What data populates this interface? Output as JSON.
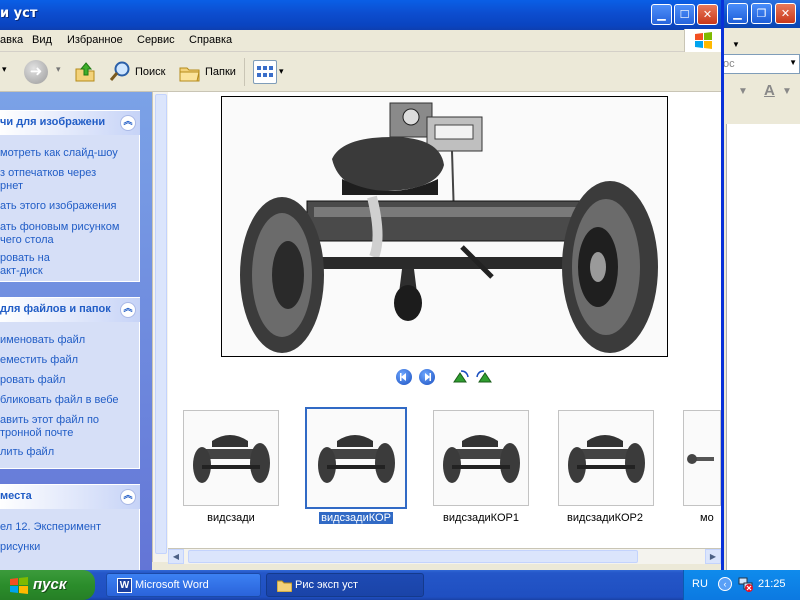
{
  "explorer": {
    "title": "и уст",
    "menu": [
      "авка",
      "Вид",
      "Избранное",
      "Сервис",
      "Справка"
    ],
    "toolbar": {
      "search_label": "Поиск",
      "folders_label": "Папки"
    }
  },
  "taskpane": {
    "image_tasks": {
      "title": "чи для изображени",
      "links": [
        "мотреть как слайд-шоу",
        "з отпечатков через\nрнет",
        "ать этого изображения",
        "ать фоновым рисунком\nчего стола",
        "ровать на\nакт-диск"
      ]
    },
    "file_tasks": {
      "title": "для файлов и папок",
      "links": [
        "именовать файл",
        "еместить файл",
        "ровать файл",
        "бликовать файл в вебе",
        "авить этот файл по\nтронной почте",
        "лить файл"
      ]
    },
    "places": {
      "title": "места",
      "links": [
        "ел 12. Эксперимент",
        "рисунки"
      ]
    }
  },
  "thumbnails": [
    {
      "label": "видсзади",
      "selected": false
    },
    {
      "label": "видсзадиКОР",
      "selected": true
    },
    {
      "label": "видсзадиКОР1",
      "selected": false
    },
    {
      "label": "видсзадиКОР2",
      "selected": false
    },
    {
      "label": "мо",
      "selected": false
    }
  ],
  "background_window": {
    "style_box_text": "ос",
    "font_color_letter": "A"
  },
  "taskbar": {
    "start_label": "пуск",
    "tasks": [
      {
        "label": "Microsoft Word",
        "active": false
      },
      {
        "label": "Рис эксп уст",
        "active": true
      }
    ],
    "language": "RU",
    "clock": "21:25"
  },
  "colors": {
    "title_blue": "#0a4fc7",
    "link_blue": "#215dc6",
    "start_green": "#2b8d2b",
    "selection_blue": "#316ac5"
  }
}
